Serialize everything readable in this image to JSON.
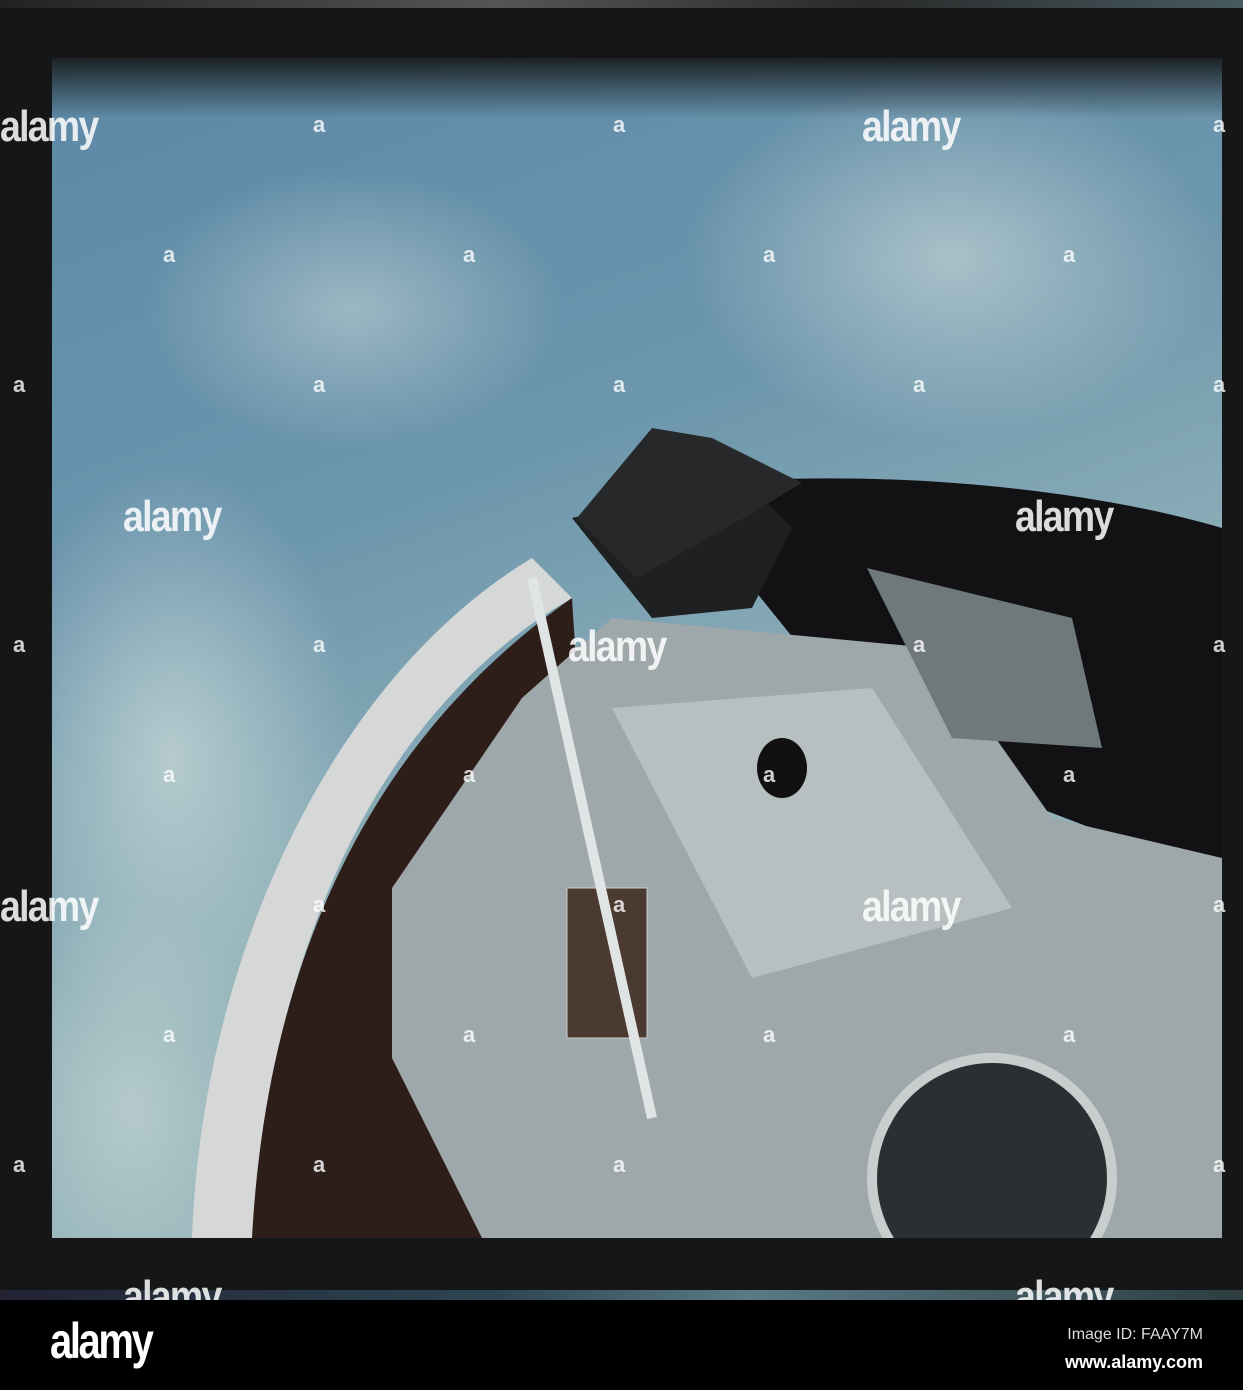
{
  "watermark": {
    "text": "alamy",
    "mark": "a"
  },
  "banner": {
    "logo": "alamy",
    "image_id": "Image ID: FAAY7M",
    "website": "www.alamy.com"
  }
}
